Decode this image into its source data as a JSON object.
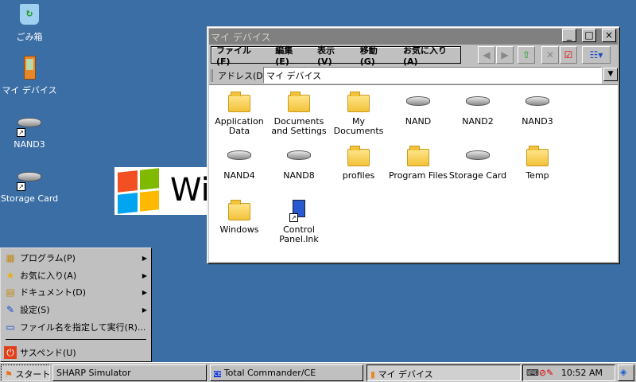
{
  "desktop": {
    "icons": [
      {
        "label": "ごみ箱"
      },
      {
        "label": "マイ デバイス"
      },
      {
        "label": "NAND3"
      },
      {
        "label": "Storage Card"
      }
    ],
    "wallpaper_text": "Wi"
  },
  "window": {
    "title": "マイ デバイス",
    "minimize": "_",
    "maximize": "□",
    "close": "×",
    "menu": [
      "ファイル(F)",
      "編集(E)",
      "表示(V)",
      "移動(G)",
      "お気に入り(A)"
    ],
    "address_label": "アドレス(D)",
    "address_value": "マイ デバイス",
    "items": [
      {
        "label": "Application Data",
        "type": "folder"
      },
      {
        "label": "Documents and Settings",
        "type": "folder"
      },
      {
        "label": "My Documents",
        "type": "folder"
      },
      {
        "label": "NAND",
        "type": "drive"
      },
      {
        "label": "NAND2",
        "type": "drive"
      },
      {
        "label": "NAND3",
        "type": "drive"
      },
      {
        "label": "NAND4",
        "type": "drive"
      },
      {
        "label": "NAND8",
        "type": "drive"
      },
      {
        "label": "profiles",
        "type": "folder"
      },
      {
        "label": "Program Files",
        "type": "folder"
      },
      {
        "label": "Storage Card",
        "type": "drive"
      },
      {
        "label": "Temp",
        "type": "folder"
      },
      {
        "label": "Windows",
        "type": "folder"
      },
      {
        "label": "Control Panel.lnk",
        "type": "shortcut"
      }
    ]
  },
  "start_menu": {
    "items": [
      "プログラム(P)",
      "お気に入り(A)",
      "ドキュメント(D)",
      "設定(S)",
      "ファイル名を指定して実行(R)...",
      "サスペンド(U)"
    ]
  },
  "taskbar": {
    "start": "スタート",
    "buttons": [
      "SHARP Simulator",
      "Total Commander/CE",
      "マイ デバイス"
    ],
    "clock": "10:52 AM"
  }
}
